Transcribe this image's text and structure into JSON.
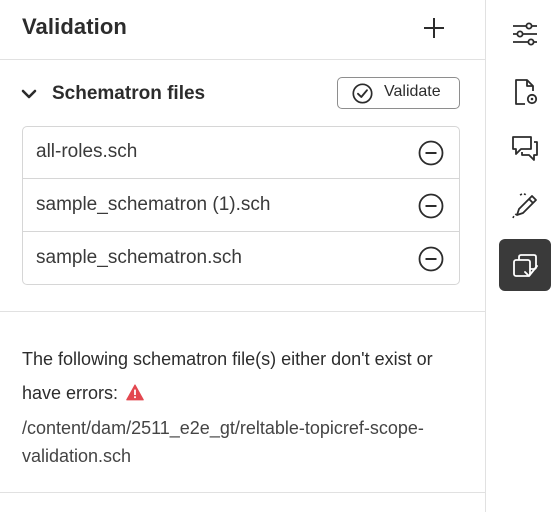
{
  "panel": {
    "title": "Validation",
    "add_icon": "plus-icon"
  },
  "section": {
    "title": "Schematron files",
    "expanded": true,
    "validate_label": "Validate"
  },
  "files": [
    {
      "name": "all-roles.sch"
    },
    {
      "name": "sample_schematron (1).sch"
    },
    {
      "name": "sample_schematron.sch"
    }
  ],
  "error": {
    "message": "The following schematron file(s) either don't exist or have errors:",
    "path": "/content/dam/2511_e2e_gt/reltable-topicref-scope-validation.sch",
    "icon": "warning-icon",
    "icon_color": "#e34850"
  },
  "rail": {
    "items": [
      {
        "icon": "settings-sliders-icon",
        "active": false
      },
      {
        "icon": "document-settings-icon",
        "active": false
      },
      {
        "icon": "comments-icon",
        "active": false
      },
      {
        "icon": "edit-draw-icon",
        "active": false
      },
      {
        "icon": "validation-icon",
        "active": true
      }
    ]
  }
}
